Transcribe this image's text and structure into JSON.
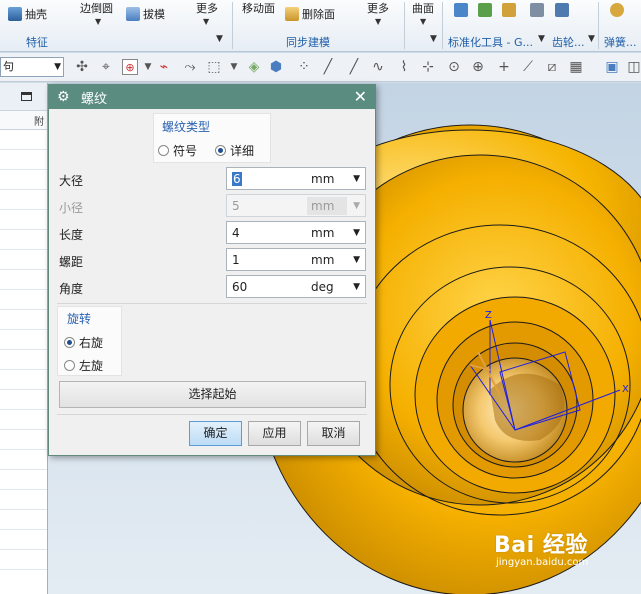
{
  "ribbon": {
    "items": {
      "shell": "抽壳",
      "edge_blend": "边倒圆",
      "draft": "拔模",
      "more1": "更多",
      "move_face": "移动面",
      "delete_face": "删除面",
      "more2": "更多",
      "surface": "曲面"
    },
    "groups": {
      "features": "特征",
      "sync_modeling": "同步建模",
      "std_tools": "标准化工具 - G...",
      "gears": "齿轮...",
      "springs": "弹簧..."
    }
  },
  "toolbar2": {
    "filter_value": "句"
  },
  "dialog": {
    "title": "螺纹",
    "thread_type": {
      "title": "螺纹类型",
      "options": [
        "符号",
        "详细"
      ],
      "selected": "详细"
    },
    "fields": [
      {
        "label": "大径",
        "value": "6",
        "unit": "mm",
        "enabled": true
      },
      {
        "label": "小径",
        "value": "5",
        "unit": "mm",
        "enabled": false
      },
      {
        "label": "长度",
        "value": "4",
        "unit": "mm",
        "enabled": true
      },
      {
        "label": "螺距",
        "value": "1",
        "unit": "mm",
        "enabled": true
      },
      {
        "label": "角度",
        "value": "60",
        "unit": "deg",
        "enabled": true
      }
    ],
    "rotation": {
      "title": "旋转",
      "options": [
        "右旋",
        "左旋"
      ],
      "selected": "右旋"
    },
    "select_start_label": "选择起始",
    "ok_label": "确定",
    "apply_label": "应用",
    "cancel_label": "取消"
  },
  "leftnav": {
    "column_header": "附"
  },
  "viewport": {
    "axis_labels": {
      "z": "Z",
      "x": "X"
    }
  },
  "watermark": {
    "brand": "Bai 经验",
    "url": "jingyan.baidu.com"
  },
  "colors": {
    "title_bar": "#5a8c80",
    "group_title": "#2a62b1",
    "part_yellow": "#f5b000",
    "csys_blue": "#2020e0"
  }
}
